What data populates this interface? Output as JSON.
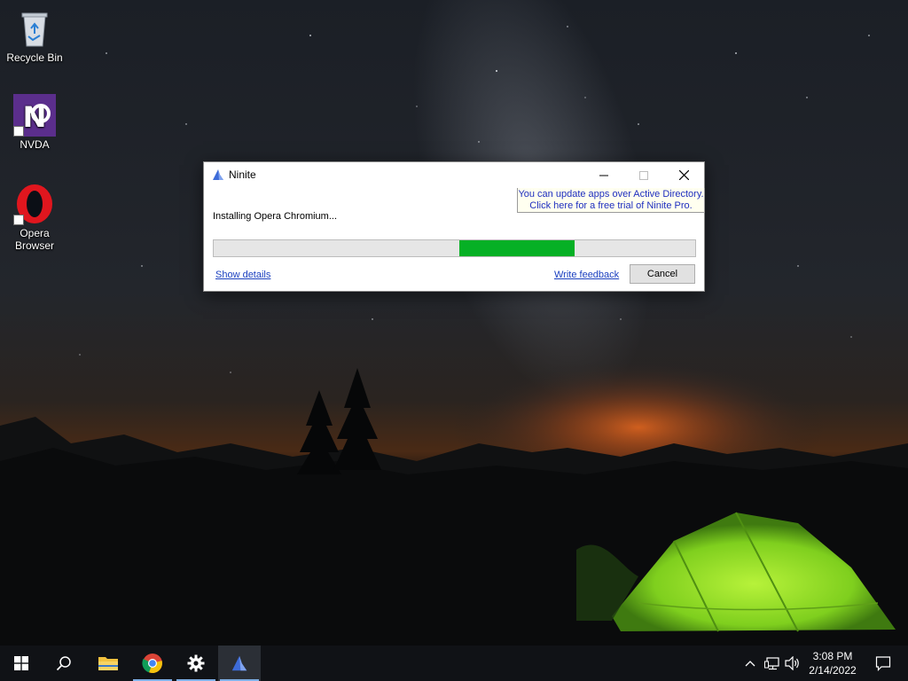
{
  "desktop": {
    "icons": [
      {
        "label": "Recycle Bin"
      },
      {
        "label": "NVDA"
      },
      {
        "label": "Opera\nBrowser"
      }
    ]
  },
  "window": {
    "title": "Ninite",
    "ad_line1": "You can update apps over Active Directory.",
    "ad_line2": "Click here for a free trial of Ninite Pro.",
    "status": "Installing Opera Chromium...",
    "progress": {
      "start": 0.51,
      "end": 0.75
    },
    "show_details_label": "Show details",
    "write_feedback_label": "Write feedback",
    "cancel_label": "Cancel"
  },
  "taskbar": {
    "clock_time": "3:08 PM",
    "clock_date": "2/14/2022"
  },
  "colors": {
    "progress_fill": "#06b025",
    "link": "#1a3fbf",
    "taskbar": "#101216"
  }
}
